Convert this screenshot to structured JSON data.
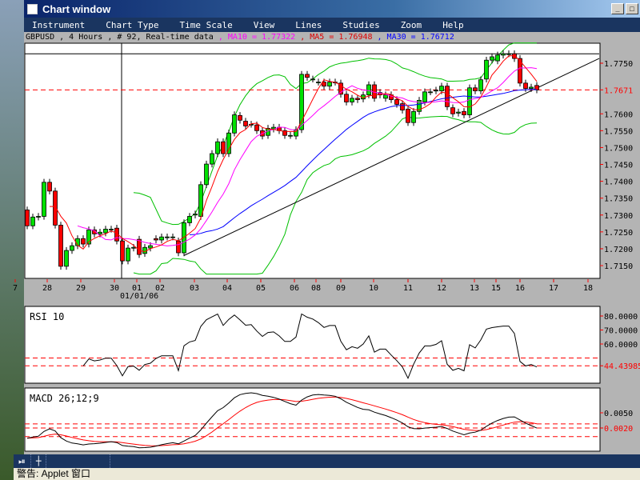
{
  "window": {
    "title": "Chart window",
    "minimize": "_",
    "maximize": "□"
  },
  "menu": [
    "Instrument",
    "Chart Type",
    "Time Scale",
    "View",
    "Lines",
    "Studies",
    "Zoom",
    "Help"
  ],
  "info": {
    "symbol_text": "GBPUSD , 4 Hours , # 92, Real-time data",
    "ma10": " , MA10 = 1.77322",
    "ma5": " , MA5 = 1.76948",
    "ma30": " , MA30 = 1.76712"
  },
  "colors": {
    "ma5": "#ff0000",
    "ma10": "#ff00ff",
    "ma30": "#0000ff",
    "bollinger": "#00c000",
    "up": "#00e000",
    "down": "#ff0000"
  },
  "chart_data": [
    {
      "type": "candlestick",
      "title": "GBPUSD 4 Hours",
      "ylim": [
        1.713,
        1.78
      ],
      "yticks": [
        "1.7750",
        "1.7600",
        "1.7550",
        "1.7500",
        "1.7450",
        "1.7400",
        "1.7350",
        "1.7300",
        "1.7250",
        "1.7200",
        "1.7150"
      ],
      "current_price": "1.7671",
      "xticks": [
        "7",
        "28",
        "29",
        "30",
        "01",
        "02",
        "03",
        "04",
        "05",
        "06",
        "08",
        "09",
        "10",
        "11",
        "12",
        "13",
        "15",
        "16",
        "17",
        "18"
      ],
      "date_label": "01/01/06",
      "open": [
        1.7315,
        1.7268,
        1.7294,
        1.7296,
        1.7397,
        1.7371,
        1.727,
        1.7148,
        1.7195,
        1.7209,
        1.723,
        1.7214,
        1.7256,
        1.7244,
        1.7247,
        1.7258,
        1.7261,
        1.7223,
        1.7164,
        1.7202,
        1.7228,
        1.7186,
        1.7202,
        1.723,
        1.7226,
        1.7235,
        1.7235,
        1.7223,
        1.7188,
        1.7277,
        1.73,
        1.7296,
        1.739,
        1.7451,
        1.7482,
        1.7517,
        1.7482,
        1.7543,
        1.7595,
        1.7578,
        1.7569,
        1.7567,
        1.755,
        1.7536,
        1.7555,
        1.756,
        1.755,
        1.7536,
        1.7534,
        1.7553,
        1.7717,
        1.7703,
        1.7694,
        1.7694,
        1.7682,
        1.7694,
        1.7691,
        1.7658,
        1.7635,
        1.7646,
        1.7644,
        1.7656,
        1.7686,
        1.7663,
        1.7646,
        1.7656,
        1.7642,
        1.763,
        1.7614,
        1.7574,
        1.7607,
        1.7635,
        1.7665,
        1.7668,
        1.7668,
        1.7682,
        1.7618,
        1.7602,
        1.7607,
        1.7597,
        1.7677,
        1.7668,
        1.7703,
        1.7759,
        1.7757,
        1.7774,
        1.7778,
        1.7778,
        1.7764,
        1.7691,
        1.7675,
        1.7684
      ],
      "close": [
        1.7268,
        1.7294,
        1.7296,
        1.7397,
        1.7371,
        1.727,
        1.7148,
        1.7195,
        1.7209,
        1.723,
        1.7214,
        1.7256,
        1.7244,
        1.7249,
        1.7258,
        1.7258,
        1.7223,
        1.7164,
        1.7202,
        1.7204,
        1.7183,
        1.7204,
        1.7209,
        1.7226,
        1.7235,
        1.7235,
        1.7235,
        1.7188,
        1.7277,
        1.7296,
        1.7303,
        1.739,
        1.7451,
        1.7482,
        1.7517,
        1.7482,
        1.7543,
        1.7597,
        1.7581,
        1.7564,
        1.7569,
        1.755,
        1.7534,
        1.7557,
        1.756,
        1.755,
        1.7536,
        1.7536,
        1.7553,
        1.7717,
        1.7708,
        1.7703,
        1.7694,
        1.7682,
        1.7694,
        1.7694,
        1.7658,
        1.7635,
        1.7646,
        1.7642,
        1.7656,
        1.7686,
        1.7646,
        1.7656,
        1.7656,
        1.7642,
        1.7628,
        1.7611,
        1.7574,
        1.7607,
        1.764,
        1.7665,
        1.7665,
        1.767,
        1.7682,
        1.7621,
        1.76,
        1.7605,
        1.7597,
        1.7677,
        1.7668,
        1.7701,
        1.7759,
        1.7769,
        1.7774,
        1.7778,
        1.7778,
        1.7764,
        1.7691,
        1.7675,
        1.7679,
        1.7671
      ]
    },
    {
      "type": "line",
      "title": "RSI 10",
      "yticks": [
        "80.0000",
        "70.0000",
        "60.0000"
      ],
      "current": "44.43985"
    },
    {
      "type": "line",
      "title": "MACD 26;12;9",
      "yticks": [
        "0.0050"
      ],
      "current": "0.0020"
    }
  ],
  "toolbar": {
    "play": "⏯",
    "crosshair": "┼"
  },
  "status": "警告: Applet 窗口"
}
